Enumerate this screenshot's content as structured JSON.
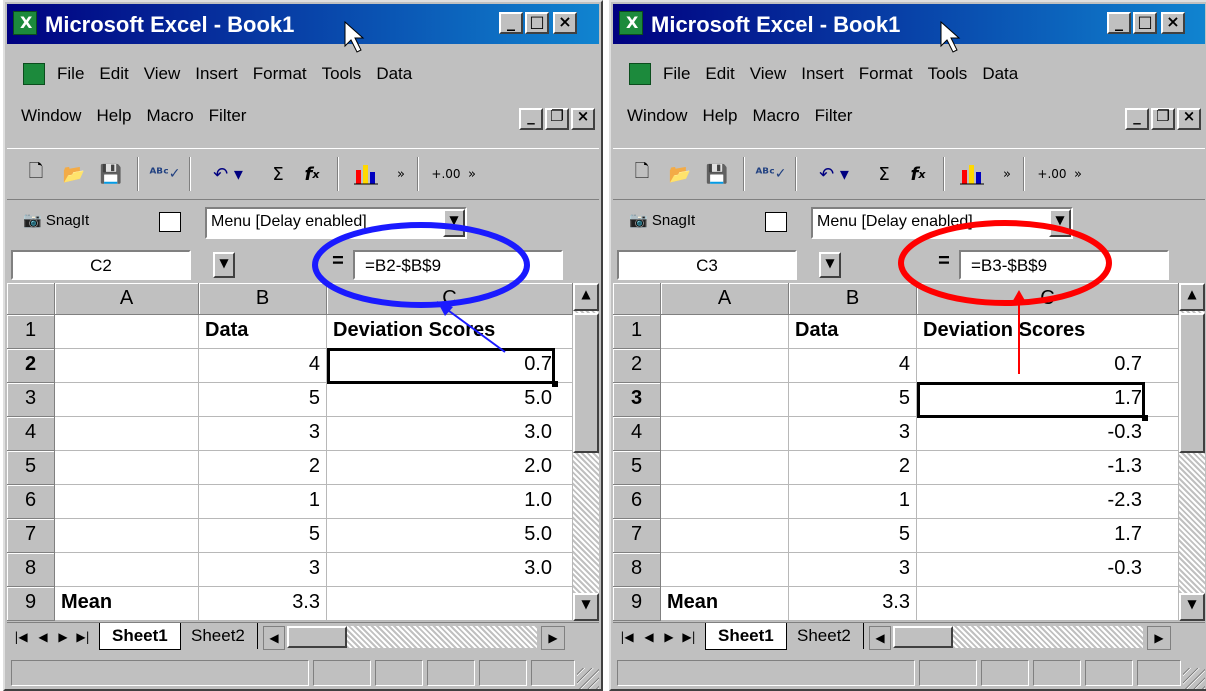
{
  "app": {
    "title": "Microsoft Excel - Book1"
  },
  "menu": {
    "row1": [
      "File",
      "Edit",
      "View",
      "Insert",
      "Format",
      "Tools",
      "Data"
    ],
    "row2": [
      "Window",
      "Help",
      "Macro",
      "Filter"
    ]
  },
  "snagit": {
    "label": "SnagIt",
    "menu_value": "Menu [Delay enabled]"
  },
  "columns": [
    "A",
    "B",
    "C"
  ],
  "row_numbers": [
    "1",
    "2",
    "3",
    "4",
    "5",
    "6",
    "7",
    "8",
    "9"
  ],
  "sheet": {
    "header_b": "Data",
    "header_c": "Deviation Scores",
    "mean_label": "Mean",
    "data": [
      "4",
      "5",
      "3",
      "2",
      "1",
      "5",
      "3"
    ],
    "mean_value": "3.3"
  },
  "tabs": [
    "Sheet1",
    "Sheet2"
  ],
  "left": {
    "name_box": "C2",
    "formula": "=B2-$B$9",
    "active_row": 2,
    "deviations": [
      "0.7",
      "5.0",
      "3.0",
      "2.0",
      "1.0",
      "5.0",
      "3.0"
    ],
    "annotation_color": "#1a1aff"
  },
  "right": {
    "name_box": "C3",
    "formula": "=B3-$B$9",
    "active_row": 3,
    "deviations": [
      "0.7",
      "1.7",
      "-0.3",
      "-1.3",
      "-2.3",
      "1.7",
      "-0.3"
    ],
    "annotation_color": "#ff0000"
  },
  "icons": {
    "toolbar": [
      "new-icon",
      "open-icon",
      "save-icon",
      "spelling-icon",
      "undo-icon",
      "autosum-icon",
      "function-icon",
      "chart-wizard-icon",
      "more-buttons-icon",
      "increase-decimal-icon"
    ]
  }
}
